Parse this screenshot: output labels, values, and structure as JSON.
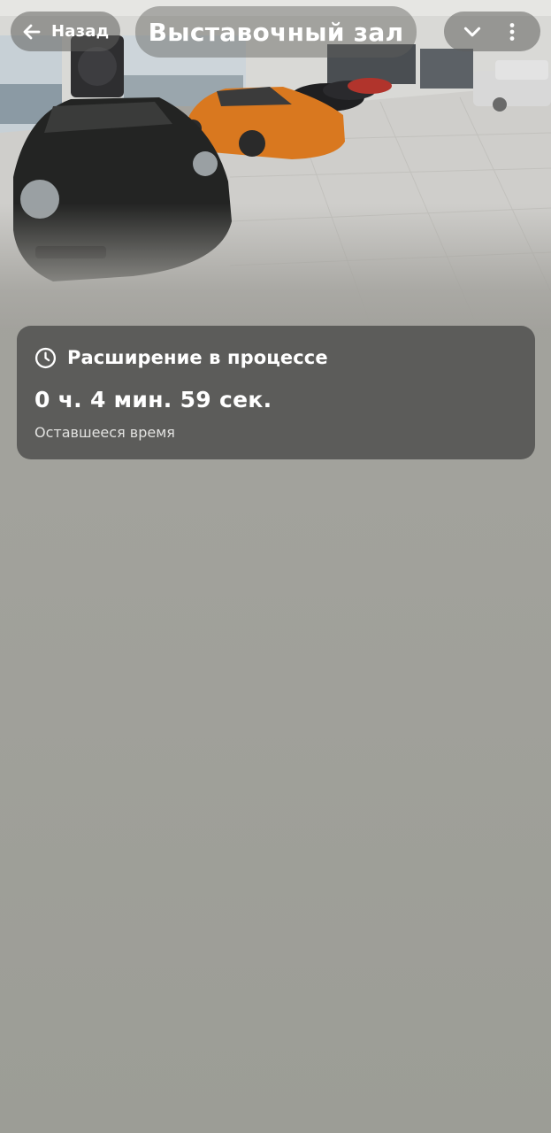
{
  "header": {
    "back_label": "Назад",
    "title": "Выставочный зал",
    "icons": {
      "back": "arrow-left-icon",
      "collapse": "chevron-down-icon",
      "more": "more-vertical-icon"
    }
  },
  "hero": {
    "image": "showroom-cars-photo"
  },
  "status": {
    "icon": "clock-icon",
    "title": "Расширение в процессе",
    "timer": "0 ч. 4 мин. 59 сек.",
    "caption": "Оставшееся время"
  },
  "colors": {
    "background": "#a2a29c",
    "card": "#5c5c5a",
    "text": "#ffffff",
    "car_orange": "#d9781f"
  }
}
